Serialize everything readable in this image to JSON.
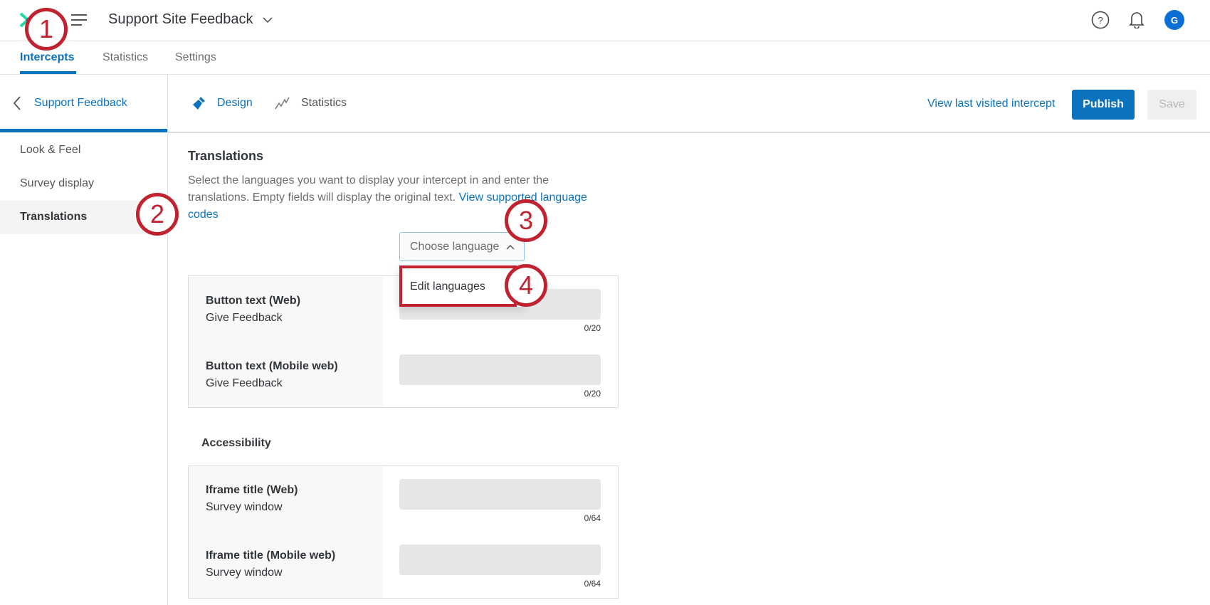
{
  "topbar": {
    "title": "Support Site Feedback",
    "avatar_initial": "G"
  },
  "tabs": [
    {
      "label": "Intercepts",
      "active": true
    },
    {
      "label": "Statistics"
    },
    {
      "label": "Settings"
    }
  ],
  "sidebar": {
    "back_label": "Support Feedback",
    "items": [
      {
        "label": "Look & Feel"
      },
      {
        "label": "Survey display"
      },
      {
        "label": "Translations",
        "selected": true
      }
    ]
  },
  "subnav": {
    "design": "Design",
    "statistics": "Statistics",
    "view_last": "View last visited intercept",
    "publish": "Publish",
    "save": "Save"
  },
  "content": {
    "heading": "Translations",
    "desc_line1": "Select the languages you want to display your intercept in and enter the",
    "desc_line2": "translations. Empty fields will display the original text.",
    "link_part1": "View supported language",
    "link_part2": "codes",
    "dropdown": {
      "label": "Choose language",
      "menu_item": "Edit languages"
    },
    "rows": [
      {
        "label": "Button text (Web)",
        "value": "Give Feedback",
        "counter": "0/20"
      },
      {
        "label": "Button text (Mobile web)",
        "value": "Give Feedback",
        "counter": "0/20"
      }
    ],
    "accessibility_heading": "Accessibility",
    "acc_rows": [
      {
        "label": "Iframe title (Web)",
        "value": "Survey window",
        "counter": "0/64"
      },
      {
        "label": "Iframe title (Mobile web)",
        "value": "Survey window",
        "counter": "0/64"
      }
    ]
  },
  "annotations": [
    "1",
    "2",
    "3",
    "4"
  ],
  "colors": {
    "accent": "#0b72c0",
    "annotation": "#c0232f"
  }
}
